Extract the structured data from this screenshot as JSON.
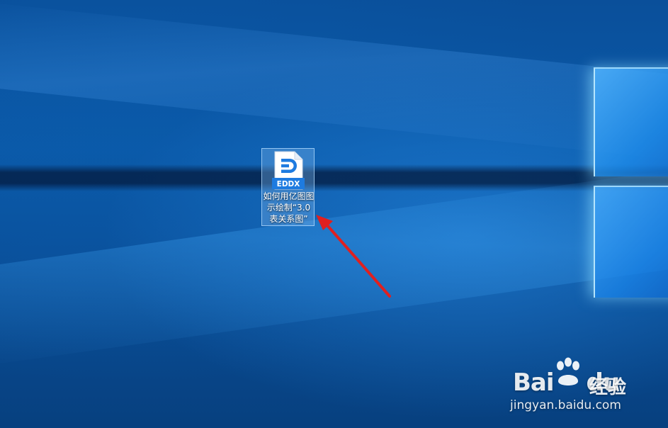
{
  "desktop": {
    "file": {
      "type_badge": "EDDX",
      "name": "如何用亿图图示绘制“3.0表关系图”",
      "icon": "eddx-file-icon",
      "selected": true
    }
  },
  "annotation": {
    "icon": "red-arrow-icon",
    "color": "#e02020"
  },
  "watermark": {
    "logo_text": "Bai",
    "logo_text_2": "du",
    "product": "经验",
    "url": "jingyan.baidu.com"
  },
  "colors": {
    "wallpaper": "#0b5aa9",
    "badge": "#1e7be0"
  }
}
